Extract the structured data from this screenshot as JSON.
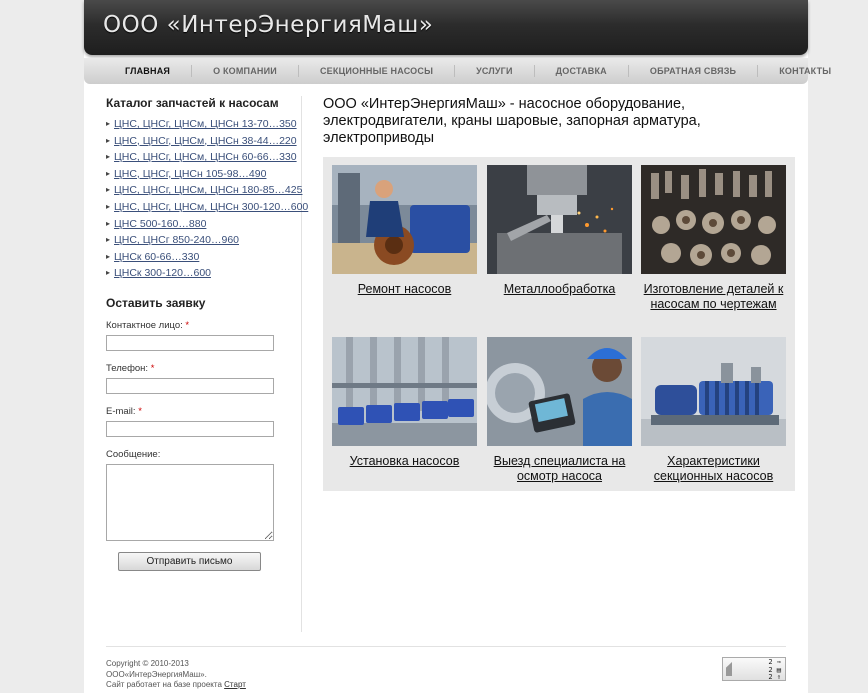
{
  "header": {
    "title": "ООО «ИнтерЭнергияМаш»"
  },
  "nav": [
    "Главная",
    "О компании",
    "Секционные насосы",
    "Услуги",
    "Доставка",
    "Обратная связь",
    "Контакты"
  ],
  "sidebar": {
    "catalog_title": "Каталог запчастей к насосам",
    "catalog": [
      "ЦНС, ЦНСг, ЦНСм, ЦНСн 13-70…350",
      "ЦНС, ЦНСг, ЦНСм, ЦНСн 38-44…220",
      "ЦНС, ЦНСг, ЦНСм, ЦНСн 60-66…330",
      "ЦНС, ЦНСг, ЦНСн 105-98…490",
      "ЦНС, ЦНСг, ЦНСм, ЦНСн 180-85…425",
      "ЦНС, ЦНСг, ЦНСм, ЦНСн 300-120…600",
      "ЦНС 500-160…880",
      "ЦНС, ЦНСг 850-240…960",
      "ЦНСк 60-66…330",
      "ЦНСк 300-120…600"
    ],
    "form": {
      "title": "Оставить заявку",
      "contact_label": "Контактное лицо:",
      "phone_label": "Телефон:",
      "email_label": "E-mail:",
      "message_label": "Сообщение:",
      "required_mark": "*",
      "submit_label": "Отправить письмо"
    }
  },
  "main": {
    "title": "ООО «ИнтерЭнергияМаш» - насосное оборудование, электродвигатели, краны шаровые, запорная арматура, электроприводы",
    "tiles": [
      "Ремонт насосов",
      "Металлообработка",
      "Изготовление деталей к насосам по чертежам",
      "Установка насосов",
      "Выезд специалиста на осмотр насоса",
      "Характеристики секционных насосов"
    ]
  },
  "footer": {
    "line1": "Copyright © 2010-2013",
    "line2": "ООО«ИнтерЭнергияМаш».",
    "line3_prefix": "Сайт работает на базе проекта",
    "line3_link": "Старт",
    "counter_lines": [
      "2 ⇒",
      "2 ▤",
      "2 ⇑"
    ]
  },
  "colors": {
    "link": "#3a4f7a",
    "required": "#cc0000",
    "header_bg": "#2c2c2c",
    "tiles_bg": "#e8e8e8"
  }
}
